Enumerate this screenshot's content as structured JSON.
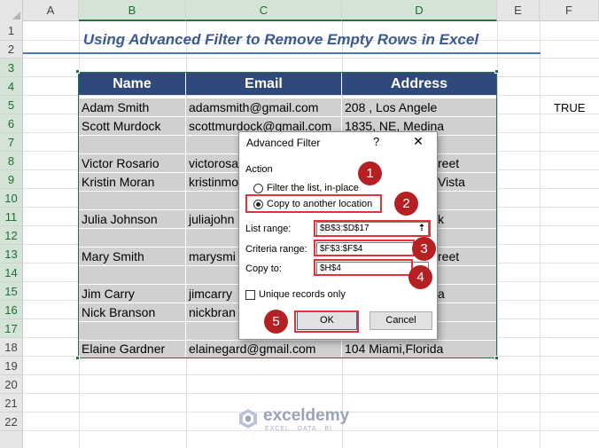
{
  "columns": [
    "A",
    "B",
    "C",
    "D",
    "E",
    "F"
  ],
  "rows": [
    "1",
    "2",
    "3",
    "4",
    "5",
    "6",
    "7",
    "8",
    "9",
    "10",
    "11",
    "12",
    "13",
    "14",
    "15",
    "16",
    "17",
    "18",
    "19",
    "20",
    "21",
    "22"
  ],
  "title": "Using Advanced Filter to Remove Empty Rows in Excel",
  "table": {
    "headers": [
      "Name",
      "Email",
      "Address"
    ],
    "rows": [
      [
        "Adam Smith",
        "adamsmith@gmail.com",
        "208 , Los Angele"
      ],
      [
        "Scott Murdock",
        "scottmurdock@gmail.com",
        "1835, NE, Medina"
      ],
      [
        "",
        "",
        ""
      ],
      [
        "Victor Rosario",
        "victorosa",
        "reet"
      ],
      [
        "Kristin Moran",
        "kristinmo",
        "Vista"
      ],
      [
        "",
        "",
        ""
      ],
      [
        "Julia Johnson",
        "juliajohn",
        "k"
      ],
      [
        "",
        "",
        ""
      ],
      [
        "Mary Smith",
        "marysmi",
        "reet"
      ],
      [
        "",
        "",
        ""
      ],
      [
        "Jim Carry",
        "jimcarry",
        "a"
      ],
      [
        "Nick Branson",
        "nickbran",
        ""
      ],
      [
        "",
        "",
        ""
      ],
      [
        "Elaine Gardner",
        "elainegard@gmail.com",
        "104 Miami,Florida"
      ]
    ]
  },
  "f4_value": "TRUE",
  "dialog": {
    "title": "Advanced Filter",
    "help": "?",
    "close": "✕",
    "action_label": "Action",
    "option_filter": "Filter the list, in-place",
    "option_copy": "Copy to another location",
    "selected_option": "copy",
    "list_range_label": "List range:",
    "list_range_value": "$B$3:$D$17",
    "criteria_range_label": "Criteria range:",
    "criteria_range_value": "$F$3:$F$4",
    "copy_to_label": "Copy to:",
    "copy_to_value": "$H$4",
    "unique_label": "Unique records only",
    "unique_checked": false,
    "ok_label": "OK",
    "cancel_label": "Cancel"
  },
  "badges": [
    "1",
    "2",
    "3",
    "4",
    "5"
  ],
  "watermark": {
    "name": "exceldemy",
    "tagline": "EXCEL · DATA · BI"
  },
  "colors": {
    "header_fill": "#2f4a7a",
    "cell_fill": "#d0d0d0",
    "title_text": "#3b5a8c",
    "highlight": "#e0343a",
    "badge": "#b52023",
    "selection": "#217346"
  }
}
